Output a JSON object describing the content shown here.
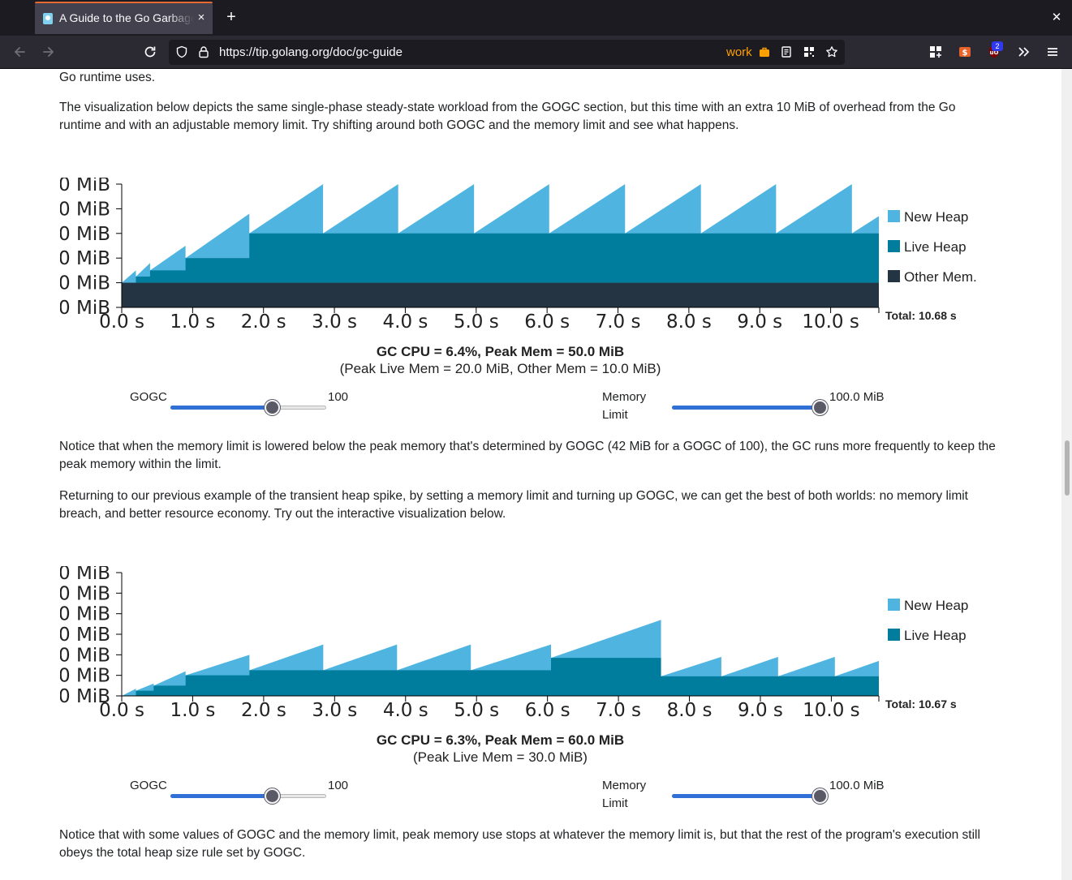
{
  "browser": {
    "tab_title": "A Guide to the Go Garbage Collector",
    "tab_close": "×",
    "new_tab": "+",
    "window_close": "✕",
    "url": "https://tip.golang.org/doc/gc-guide",
    "container_label": "work",
    "ublock_count": "2"
  },
  "page": {
    "intro_tail": "Go runtime uses.",
    "para1": "The visualization below depicts the same single-phase steady-state workload from the GOGC section, but this time with an extra 10 MiB of overhead from the Go runtime and with an adjustable memory limit. Try shifting around both GOGC and the memory limit and see what happens.",
    "para2": "Notice that when the memory limit is lowered below the peak memory that's determined by GOGC (42 MiB for a GOGC of 100), the GC runs more frequently to keep the peak memory within the limit.",
    "para3": "Returning to our previous example of the transient heap spike, by setting a memory limit and turning up GOGC, we can get the best of both worlds: no memory limit breach, and better resource economy. Try out the interactive visualization below.",
    "para4": "Notice that with some values of GOGC and the memory limit, peak memory use stops at whatever the memory limit is, but that the rest of the program's execution still obeys the total heap size rule set by GOGC."
  },
  "viz1": {
    "summary_bold": "GC CPU = 6.4%, Peak Mem = 50.0 MiB",
    "summary_detail": "(Peak Live Mem = 20.0 MiB, Other Mem = 10.0 MiB)",
    "gogc_label": "GOGC",
    "gogc_value": "100",
    "gogc_fraction": 0.65,
    "memlimit_label_1": "Memory",
    "memlimit_label_2": "Limit",
    "memlimit_value": "100.0 MiB",
    "memlimit_fraction": 1.0
  },
  "viz2": {
    "summary_bold": "GC CPU = 6.3%, Peak Mem = 60.0 MiB",
    "summary_detail": "(Peak Live Mem = 30.0 MiB)",
    "gogc_label": "GOGC",
    "gogc_value": "100",
    "gogc_fraction": 0.65,
    "memlimit_label_1": "Memory",
    "memlimit_label_2": "Limit",
    "memlimit_value": "100.0 MiB",
    "memlimit_fraction": 1.0
  },
  "colors": {
    "new_heap": "#4fb5e0",
    "live_heap": "#007d9c",
    "other_mem": "#253443",
    "slider_fill": "#2f6fd6"
  },
  "chart_data": [
    {
      "type": "area",
      "stacked": true,
      "y_tick_labels": [
        "0 MiB",
        "0 MiB",
        "0 MiB",
        "0 MiB",
        "0 MiB",
        "0 MiB"
      ],
      "y_tick_values": [
        0,
        10,
        20,
        30,
        40,
        50
      ],
      "ylim": [
        0,
        50
      ],
      "x_tick_labels": [
        "0.0 s",
        "1.0 s",
        "2.0 s",
        "3.0 s",
        "4.0 s",
        "5.0 s",
        "6.0 s",
        "7.0 s",
        "8.0 s",
        "9.0 s",
        "10.0 s"
      ],
      "x_tick_values": [
        0,
        1,
        2,
        3,
        4,
        5,
        6,
        7,
        8,
        9,
        10
      ],
      "xlim": [
        0,
        10.68
      ],
      "total_label": "Total: 10.68 s",
      "legend": [
        "New Heap",
        "Live Heap",
        "Other Mem."
      ],
      "legend_position": "right",
      "series": [
        {
          "name": "Other Mem.",
          "x": [
            0,
            10.68
          ],
          "y": [
            10,
            10
          ]
        },
        {
          "name": "Live Heap",
          "x": [
            0,
            0.2,
            0.2,
            0.4,
            0.4,
            0.9,
            0.9,
            1.8,
            1.8,
            10.68
          ],
          "y": [
            0,
            0,
            2.5,
            2.5,
            5,
            5,
            10,
            10,
            20,
            20
          ]
        },
        {
          "name": "New Heap",
          "total_peaks": [
            [
              0,
              10
            ],
            [
              0.2,
              15
            ],
            [
              0.2,
              12.5
            ],
            [
              0.4,
              18
            ],
            [
              0.4,
              15
            ],
            [
              0.9,
              25
            ],
            [
              0.9,
              20
            ],
            [
              1.8,
              38
            ],
            [
              1.8,
              30
            ],
            [
              2.84,
              50
            ],
            [
              2.84,
              30
            ],
            [
              3.9,
              50
            ],
            [
              3.9,
              30
            ],
            [
              4.97,
              50
            ],
            [
              4.97,
              30
            ],
            [
              6.03,
              50
            ],
            [
              6.03,
              30
            ],
            [
              7.1,
              50
            ],
            [
              7.1,
              30
            ],
            [
              8.17,
              50
            ],
            [
              8.17,
              30
            ],
            [
              9.23,
              50
            ],
            [
              9.23,
              30
            ],
            [
              10.3,
              50
            ],
            [
              10.3,
              30
            ],
            [
              10.68,
              37
            ]
          ]
        }
      ]
    },
    {
      "type": "area",
      "stacked": true,
      "y_tick_labels": [
        "0 MiB",
        "0 MiB",
        "0 MiB",
        "0 MiB",
        "0 MiB",
        "0 MiB",
        "0 MiB"
      ],
      "y_tick_values": [
        0,
        10,
        20,
        30,
        40,
        50,
        60
      ],
      "ylim": [
        0,
        60
      ],
      "x_tick_labels": [
        "0.0 s",
        "1.0 s",
        "2.0 s",
        "3.0 s",
        "4.0 s",
        "5.0 s",
        "6.0 s",
        "7.0 s",
        "8.0 s",
        "9.0 s",
        "10.0 s"
      ],
      "x_tick_values": [
        0,
        1,
        2,
        3,
        4,
        5,
        6,
        7,
        8,
        9,
        10
      ],
      "xlim": [
        0,
        10.67
      ],
      "total_label": "Total: 10.67 s",
      "legend": [
        "New Heap",
        "Live Heap"
      ],
      "legend_position": "right",
      "series": [
        {
          "name": "Live Heap",
          "x": [
            0,
            0.2,
            0.2,
            0.45,
            0.45,
            0.9,
            0.9,
            1.8,
            1.8,
            6.05,
            6.05,
            7.6,
            7.6,
            10.67
          ],
          "y": [
            0,
            0,
            2.5,
            2.5,
            5,
            5,
            10,
            10,
            12.5,
            12.5,
            18.5,
            18.5,
            9.5,
            9.5
          ]
        },
        {
          "name": "New Heap",
          "total_peaks": [
            [
              0,
              0
            ],
            [
              0.2,
              3.5
            ],
            [
              0.2,
              2.5
            ],
            [
              0.45,
              6
            ],
            [
              0.45,
              5
            ],
            [
              0.9,
              12
            ],
            [
              0.9,
              10
            ],
            [
              1.8,
              20
            ],
            [
              1.8,
              12.5
            ],
            [
              2.84,
              25
            ],
            [
              2.84,
              12.5
            ],
            [
              3.88,
              25
            ],
            [
              3.88,
              12.5
            ],
            [
              4.92,
              25
            ],
            [
              4.92,
              12.5
            ],
            [
              6.05,
              25
            ],
            [
              6.05,
              18.5
            ],
            [
              7.6,
              37
            ],
            [
              7.6,
              9.5
            ],
            [
              8.45,
              19
            ],
            [
              8.45,
              9.5
            ],
            [
              9.25,
              19
            ],
            [
              9.25,
              9.5
            ],
            [
              10.05,
              19
            ],
            [
              10.05,
              9.5
            ],
            [
              10.67,
              17
            ]
          ]
        }
      ]
    }
  ]
}
